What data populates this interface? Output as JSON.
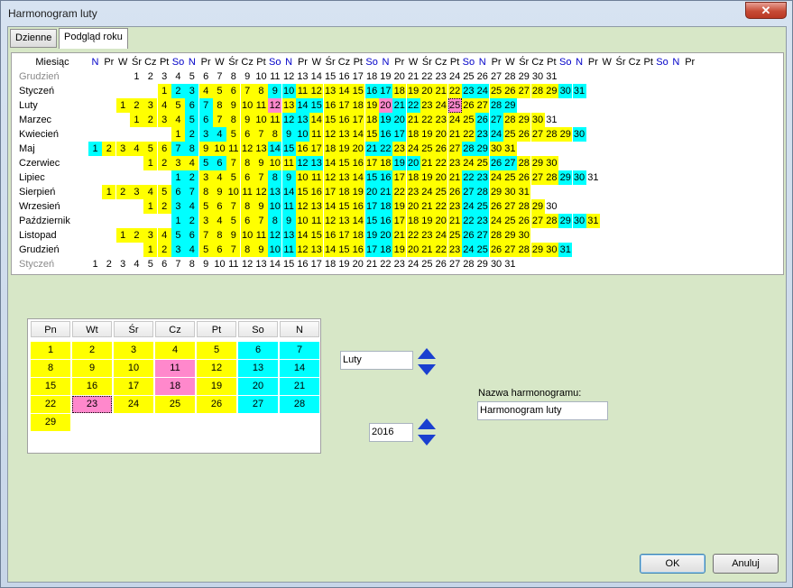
{
  "window": {
    "title": "Harmonogram luty",
    "close_label": "✕"
  },
  "tabs": [
    {
      "label": "Dzienne",
      "active": false
    },
    {
      "label": "Podgląd roku",
      "active": true
    }
  ],
  "year_view": {
    "month_column_header": "Miesiąc",
    "day_headers": [
      "N",
      "Pr",
      "W",
      "Śr",
      "Cz",
      "Pt",
      "So",
      "N",
      "Pr",
      "W",
      "Śr",
      "Cz",
      "Pt",
      "So",
      "N",
      "Pr",
      "W",
      "Śr",
      "Cz",
      "Pt",
      "So",
      "N",
      "Pr",
      "W",
      "Śr",
      "Cz",
      "Pt",
      "So",
      "N",
      "Pr",
      "W",
      "Śr",
      "Cz",
      "Pt",
      "So",
      "N",
      "Pr",
      "W",
      "Śr",
      "Cz",
      "Pt",
      "So",
      "N",
      "Pr"
    ],
    "months": [
      {
        "name": "Grudzień",
        "muted": true,
        "days": "---123456789012345678901234567890123",
        "cells": [
          "",
          "",
          "",
          "1",
          "2",
          "3",
          "4",
          "5",
          "6",
          "7",
          "8",
          "9",
          "10",
          "11",
          "12",
          "13",
          "14",
          "15",
          "16",
          "17",
          "18",
          "19",
          "20",
          "21",
          "22",
          "23",
          "24",
          "25",
          "26",
          "27",
          "28",
          "29",
          "30",
          "31"
        ],
        "colors": ""
      },
      {
        "name": "Styczeń",
        "muted": false,
        "cells": [
          "",
          "",
          "",
          "",
          "",
          "1",
          "2",
          "3",
          "4",
          "5",
          "6",
          "7",
          "8",
          "9",
          "10",
          "11",
          "12",
          "13",
          "14",
          "15",
          "16",
          "17",
          "18",
          "19",
          "20",
          "21",
          "22",
          "23",
          "24",
          "25",
          "26",
          "27",
          "28",
          "29",
          "30",
          "31"
        ],
        "colors": ".....yccyyyyyccyyyyyccyyyyyccyyyyycc"
      },
      {
        "name": "Luty",
        "muted": false,
        "cells": [
          "",
          "",
          "1",
          "2",
          "3",
          "4",
          "5",
          "6",
          "7",
          "8",
          "9",
          "10",
          "11",
          "12",
          "13",
          "14",
          "15",
          "16",
          "17",
          "18",
          "19",
          "20",
          "21",
          "22",
          "23",
          "24",
          "25",
          "26",
          "27",
          "28",
          "29"
        ],
        "colors": "..yyyyyccyyyypyccyyyypccyyoyyccy"
      },
      {
        "name": "Marzec",
        "muted": false,
        "cells": [
          "",
          "",
          "",
          "1",
          "2",
          "3",
          "4",
          "5",
          "6",
          "7",
          "8",
          "9",
          "10",
          "11",
          "12",
          "13",
          "14",
          "15",
          "16",
          "17",
          "18",
          "19",
          "20",
          "21",
          "22",
          "23",
          "24",
          "25",
          "26",
          "27",
          "28",
          "29",
          "30",
          "31"
        ],
        "colors": "...yyyyccyyyyyccyyyyyccyyyyyccyyy"
      },
      {
        "name": "Kwiecień",
        "muted": false,
        "cells": [
          "",
          "",
          "",
          "",
          "",
          "",
          "1",
          "2",
          "3",
          "4",
          "5",
          "6",
          "7",
          "8",
          "9",
          "10",
          "11",
          "12",
          "13",
          "14",
          "15",
          "16",
          "17",
          "18",
          "19",
          "20",
          "21",
          "22",
          "23",
          "24",
          "25",
          "26",
          "27",
          "28",
          "29",
          "30"
        ],
        "colors": "......ycccyyyyccyyyyyccyyyyyccyyyyyc"
      },
      {
        "name": "Maj",
        "muted": false,
        "cells": [
          "1",
          "2",
          "3",
          "4",
          "5",
          "6",
          "7",
          "8",
          "9",
          "10",
          "11",
          "12",
          "13",
          "14",
          "15",
          "16",
          "17",
          "18",
          "19",
          "20",
          "21",
          "22",
          "23",
          "24",
          "25",
          "26",
          "27",
          "28",
          "29",
          "30",
          "31"
        ],
        "colors": "cyyyyyccyyyyyccyyyyyccyyyyyccyy"
      },
      {
        "name": "Czerwiec",
        "muted": false,
        "cells": [
          "",
          "",
          "",
          "",
          "1",
          "2",
          "3",
          "4",
          "5",
          "6",
          "7",
          "8",
          "9",
          "10",
          "11",
          "12",
          "13",
          "14",
          "15",
          "16",
          "17",
          "18",
          "19",
          "20",
          "21",
          "22",
          "23",
          "24",
          "25",
          "26",
          "27",
          "28",
          "29",
          "30"
        ],
        "colors": "....yyyyccyyyyyccyyyyyccyyyyyccyyy"
      },
      {
        "name": "Lipiec",
        "muted": false,
        "cells": [
          "",
          "",
          "",
          "",
          "",
          "",
          "1",
          "2",
          "3",
          "4",
          "5",
          "6",
          "7",
          "8",
          "9",
          "10",
          "11",
          "12",
          "13",
          "14",
          "15",
          "16",
          "17",
          "18",
          "19",
          "20",
          "21",
          "22",
          "23",
          "24",
          "25",
          "26",
          "27",
          "28",
          "29",
          "30",
          "31"
        ],
        "colors": "......ccyyyyyccyyyyyccyyyyyccyyyyycc"
      },
      {
        "name": "Sierpień",
        "muted": false,
        "cells": [
          "",
          "1",
          "2",
          "3",
          "4",
          "5",
          "6",
          "7",
          "8",
          "9",
          "10",
          "11",
          "12",
          "13",
          "14",
          "15",
          "16",
          "17",
          "18",
          "19",
          "20",
          "21",
          "22",
          "23",
          "24",
          "25",
          "26",
          "27",
          "28",
          "29",
          "30",
          "31"
        ],
        "colors": ".yyyyyccyyyyyccyyyyyccyyyyyccyyy"
      },
      {
        "name": "Wrzesień",
        "muted": false,
        "cells": [
          "",
          "",
          "",
          "",
          "1",
          "2",
          "3",
          "4",
          "5",
          "6",
          "7",
          "8",
          "9",
          "10",
          "11",
          "12",
          "13",
          "14",
          "15",
          "16",
          "17",
          "18",
          "19",
          "20",
          "21",
          "22",
          "23",
          "24",
          "25",
          "26",
          "27",
          "28",
          "29",
          "30"
        ],
        "colors": "....yyccyyyyyccyyyyyccyyyyyccyyyy"
      },
      {
        "name": "Październik",
        "muted": false,
        "cells": [
          "",
          "",
          "",
          "",
          "",
          "",
          "1",
          "2",
          "3",
          "4",
          "5",
          "6",
          "7",
          "8",
          "9",
          "10",
          "11",
          "12",
          "13",
          "14",
          "15",
          "16",
          "17",
          "18",
          "19",
          "20",
          "21",
          "22",
          "23",
          "24",
          "25",
          "26",
          "27",
          "28",
          "29",
          "30",
          "31"
        ],
        "colors": "......ccyyyyyccyyyyyccyyyyyccyyyyyccy"
      },
      {
        "name": "Listopad",
        "muted": false,
        "cells": [
          "",
          "",
          "1",
          "2",
          "3",
          "4",
          "5",
          "6",
          "7",
          "8",
          "9",
          "10",
          "11",
          "12",
          "13",
          "14",
          "15",
          "16",
          "17",
          "18",
          "19",
          "20",
          "21",
          "22",
          "23",
          "24",
          "25",
          "26",
          "27",
          "28",
          "29",
          "30"
        ],
        "colors": "..yyyyccyyyyyccyyyyyccyyyyyccyyy"
      },
      {
        "name": "Grudzień",
        "muted": false,
        "cells": [
          "",
          "",
          "",
          "",
          "1",
          "2",
          "3",
          "4",
          "5",
          "6",
          "7",
          "8",
          "9",
          "10",
          "11",
          "12",
          "13",
          "14",
          "15",
          "16",
          "17",
          "18",
          "19",
          "20",
          "21",
          "22",
          "23",
          "24",
          "25",
          "26",
          "27",
          "28",
          "29",
          "30",
          "31"
        ],
        "colors": "....yyccyyyyyccyyyyyccyyyyyccyyyyyc"
      },
      {
        "name": "Styczeń",
        "muted": true,
        "cells": [
          "1",
          "2",
          "3",
          "4",
          "5",
          "6",
          "7",
          "8",
          "9",
          "10",
          "11",
          "12",
          "13",
          "14",
          "15",
          "16",
          "17",
          "18",
          "19",
          "20",
          "21",
          "22",
          "23",
          "24",
          "25",
          "26",
          "27",
          "28",
          "29",
          "30",
          "31"
        ],
        "colors": ""
      }
    ]
  },
  "month_view": {
    "weekday_headers": [
      "Pn",
      "Wt",
      "Śr",
      "Cz",
      "Pt",
      "So",
      "N"
    ],
    "weeks": [
      [
        "1",
        "2",
        "3",
        "4",
        "5",
        "6",
        "7"
      ],
      [
        "8",
        "9",
        "10",
        "11",
        "12",
        "13",
        "14"
      ],
      [
        "15",
        "16",
        "17",
        "18",
        "19",
        "20",
        "21"
      ],
      [
        "22",
        "23",
        "24",
        "25",
        "26",
        "27",
        "28"
      ],
      [
        "29",
        "",
        "",
        "",
        "",
        "",
        ""
      ]
    ],
    "colors": [
      "yyyyycc",
      "yyypycc",
      "yyypycc",
      "yoyyycc",
      "y......"
    ]
  },
  "controls": {
    "month_value": "Luty",
    "year_value": "2016",
    "schedule_name_label": "Nazwa harmonogramu:",
    "schedule_name_value": "Harmonogram luty",
    "ok_label": "OK",
    "cancel_label": "Anuluj"
  },
  "colors": {
    "workday": "#ffff00",
    "weekend": "#00ffff",
    "special": "#ff88cc",
    "spin_arrow": "#1a3fd0"
  }
}
